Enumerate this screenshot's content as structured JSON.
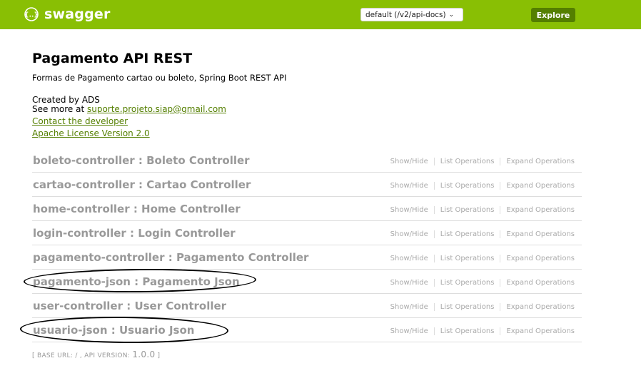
{
  "header": {
    "logo_text": "swagger",
    "spec_select_value": "default (/v2/api-docs)",
    "explore_label": "Explore",
    "brand_color": "#89bf04",
    "button_color": "#547f00"
  },
  "info": {
    "title": "Pagamento API REST",
    "description": "Formas de Pagamento cartao ou boleto, Spring Boot REST API",
    "created_by": "Created by ADS",
    "see_more_prefix": "See more at ",
    "email": "suporte.projeto.siap@gmail.com",
    "contact": "Contact the developer",
    "license": "Apache License Version 2.0"
  },
  "resources": [
    {
      "title": "boleto-controller : Boleto Controller",
      "show_hide": "Show/Hide",
      "list_ops": "List Operations",
      "expand_ops": "Expand Operations"
    },
    {
      "title": "cartao-controller : Cartao Controller",
      "show_hide": "Show/Hide",
      "list_ops": "List Operations",
      "expand_ops": "Expand Operations"
    },
    {
      "title": "home-controller : Home Controller",
      "show_hide": "Show/Hide",
      "list_ops": "List Operations",
      "expand_ops": "Expand Operations"
    },
    {
      "title": "login-controller : Login Controller",
      "show_hide": "Show/Hide",
      "list_ops": "List Operations",
      "expand_ops": "Expand Operations"
    },
    {
      "title": "pagamento-controller : Pagamento Controller",
      "show_hide": "Show/Hide",
      "list_ops": "List Operations",
      "expand_ops": "Expand Operations"
    },
    {
      "title": "pagamento-json : Pagamento Json",
      "show_hide": "Show/Hide",
      "list_ops": "List Operations",
      "expand_ops": "Expand Operations"
    },
    {
      "title": "user-controller : User Controller",
      "show_hide": "Show/Hide",
      "list_ops": "List Operations",
      "expand_ops": "Expand Operations"
    },
    {
      "title": "usuario-json : Usuario Json",
      "show_hide": "Show/Hide",
      "list_ops": "List Operations",
      "expand_ops": "Expand Operations"
    }
  ],
  "footer": {
    "open_bracket": "[ ",
    "base_url_label": "BASE URL",
    "base_url_value": ": / , ",
    "api_version_label": "API VERSION",
    "api_version_sep": ": ",
    "api_version_value": "1.0.0",
    "close_bracket": " ]"
  }
}
